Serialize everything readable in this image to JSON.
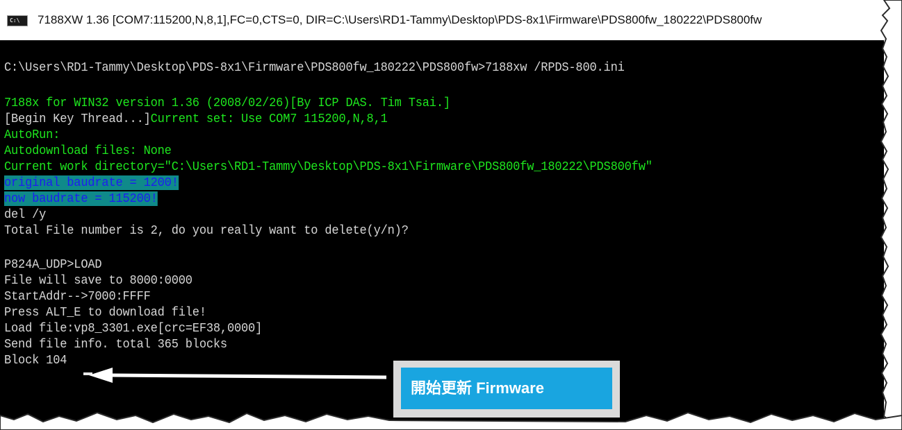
{
  "window": {
    "icon_label": "C:\\",
    "title": "7188XW 1.36 [COM7:115200,N,8,1],FC=0,CTS=0, DIR=C:\\Users\\RD1-Tammy\\Desktop\\PDS-8x1\\Firmware\\PDS800fw_180222\\PDS800fw"
  },
  "console": {
    "lines": [
      {
        "text": "C:\\Users\\RD1-Tammy\\Desktop\\PDS-8x1\\Firmware\\PDS800fw_180222\\PDS800fw>7188xw /RPDS-800.ini",
        "style": "white"
      },
      {
        "text": "7188x for WIN32 version 1.36 (2008/02/26)[By ICP DAS. Tim Tsai.]",
        "style": "green"
      },
      {
        "text": "Current set: Use COM7 115200,N,8,1",
        "style": "green"
      },
      {
        "text": "AutoRun:",
        "style": "green"
      },
      {
        "text": "Autodownload files: None",
        "style": "green"
      },
      {
        "text": "Current work directory=\"C:\\Users\\RD1-Tammy\\Desktop\\PDS-8x1\\Firmware\\PDS800fw_180222\\PDS800fw\"",
        "style": "green"
      },
      {
        "text": "original baudrate = 1200!",
        "style": "hl"
      },
      {
        "text": "now baudrate = 115200!",
        "style": "hl"
      },
      {
        "text": "del /y",
        "style": "white"
      },
      {
        "text": "Total File number is 2, do you really want to delete(y/n)?",
        "style": "white"
      },
      {
        "text": "P824A_UDP>LOAD",
        "style": "white"
      },
      {
        "text": "File will save to 8000:0000",
        "style": "white"
      },
      {
        "text": "StartAddr-->7000:FFFF",
        "style": "white"
      },
      {
        "text": "Press ALT_E to download file!",
        "style": "white"
      },
      {
        "text": "Load file:vp8_3301.exe[crc=EF38,0000]",
        "style": "white"
      },
      {
        "text": "Send file info. total 365 blocks",
        "style": "white"
      },
      {
        "text": "Block 104",
        "style": "white"
      }
    ],
    "thread_prefix": "[Begin Key Thread...]"
  },
  "callout": {
    "text": "開始更新 Firmware",
    "color": "#19a5e0"
  }
}
